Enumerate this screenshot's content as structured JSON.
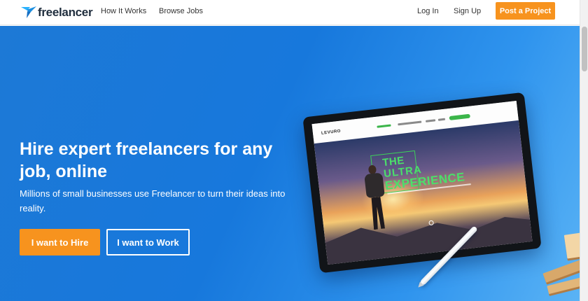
{
  "header": {
    "brand": "freelancer",
    "nav": {
      "how_it_works": "How It Works",
      "browse_jobs": "Browse Jobs",
      "login": "Log In",
      "signup": "Sign Up"
    },
    "post_project": "Post a Project"
  },
  "hero": {
    "title": "Hire expert freelancers for any job, online",
    "subtitle": "Millions of small businesses use Freelancer to turn their ideas into reality.",
    "hire_button": "I want to Hire",
    "work_button": "I want to Work",
    "illustration": {
      "screen_brand": "LEVURO",
      "headline_1": "THE",
      "headline_2": "ULTRA",
      "headline_3": "EXPERIENCE"
    }
  },
  "colors": {
    "brand_orange": "#f7931e",
    "hero_blue": "#1778dc",
    "logo_blue": "#29b2fe",
    "promo_green": "#4be06a"
  },
  "icons": {
    "logo": "freelancer-bird-icon"
  }
}
